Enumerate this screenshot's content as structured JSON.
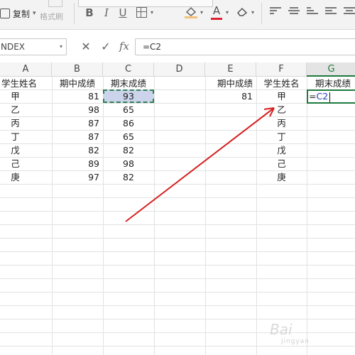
{
  "toolbar": {
    "copy_label": "复制",
    "format_painter_label": "格式刷",
    "bold": "B",
    "italic": "I",
    "underline": "U",
    "font_color_glyph": "A",
    "icons": [
      "copy-icon",
      "format-painter-icon",
      "bold-icon",
      "italic-icon",
      "underline-icon",
      "borders-icon",
      "fill-color-icon",
      "font-color-icon",
      "clear-format-icon",
      "align-top-icon",
      "align-middle-icon",
      "align-bottom-icon",
      "align-left-icon",
      "align-center-icon"
    ],
    "colors": {
      "fill_bar": "#f4c27a",
      "font_color_bar": "#dd2233"
    }
  },
  "formula_bar": {
    "name_box": "NDEX",
    "cancel_glyph": "✕",
    "confirm_glyph": "✓",
    "fx_label": "fx",
    "formula": "=C2"
  },
  "sheet": {
    "columns": [
      "A",
      "B",
      "C",
      "D",
      "E",
      "F",
      "G"
    ],
    "active_column": "G",
    "left_table": {
      "headers": [
        "学生姓名",
        "期中成绩",
        "期末成绩"
      ],
      "rows": [
        [
          "甲",
          "81",
          "93"
        ],
        [
          "乙",
          "98",
          "65"
        ],
        [
          "丙",
          "87",
          "86"
        ],
        [
          "丁",
          "87",
          "65"
        ],
        [
          "戊",
          "82",
          "82"
        ],
        [
          "己",
          "89",
          "98"
        ],
        [
          "庚",
          "97",
          "82"
        ]
      ]
    },
    "right_table": {
      "headers": [
        "期中成绩",
        "学生姓名",
        "期末成绩"
      ],
      "e2": "81",
      "names": [
        "甲",
        "乙",
        "丙",
        "丁",
        "戊",
        "己",
        "庚"
      ],
      "g2_prefix": "=",
      "g2_ref": "C2"
    },
    "colors": {
      "selected_fill": "#cbd4ea",
      "active_border": "#1f7a3c",
      "ref_text": "#1b3fb8",
      "arrow": "#d62020"
    }
  },
  "watermark": {
    "text": "Bai",
    "sub": "jingyan"
  }
}
